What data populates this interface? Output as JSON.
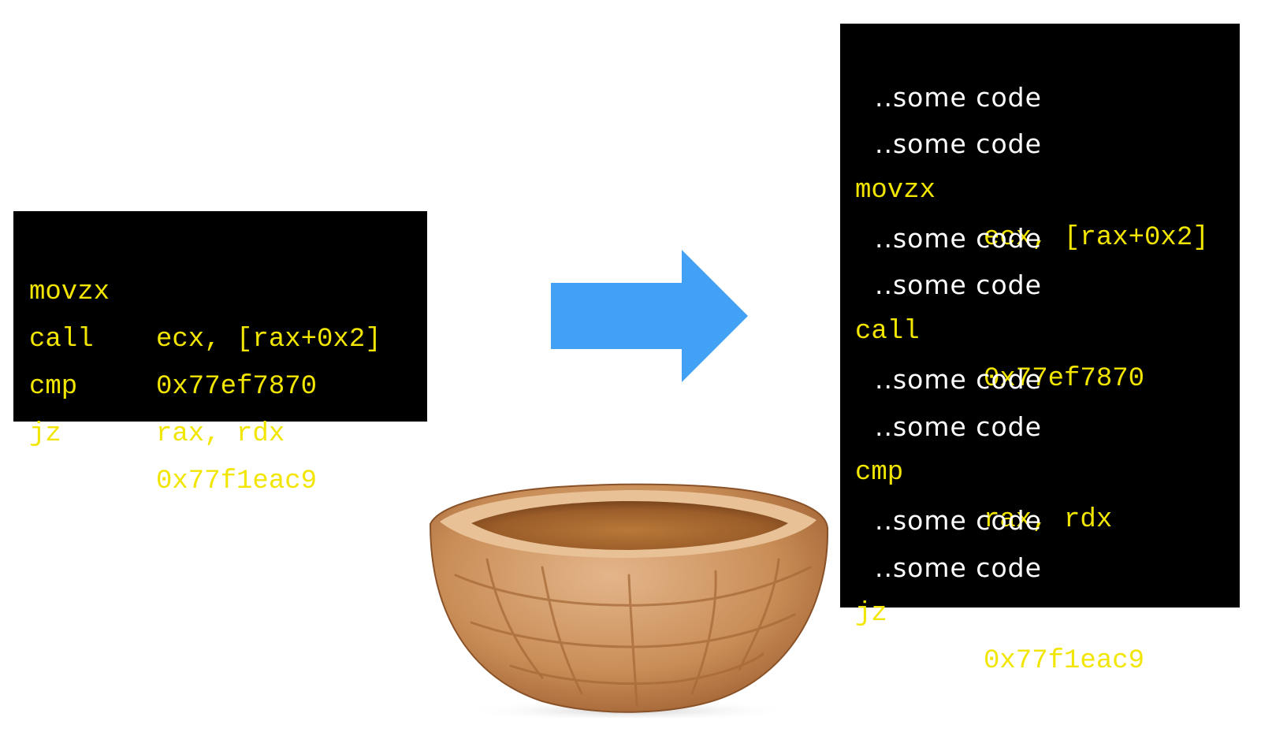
{
  "colors": {
    "background": "#ffffff",
    "panel": "#000000",
    "instruction_text": "#f2e600",
    "filler_text": "#ffffff",
    "arrow": "#42a1f4",
    "shell_light": "#e4b58a",
    "shell_dark": "#9a5a2c"
  },
  "icons": {
    "arrow": "right-arrow-icon",
    "shell": "walnut-shell-illustration"
  },
  "original_snippet": {
    "lines": [
      {
        "mnemonic": "movzx",
        "operand": "ecx, [rax+0x2]"
      },
      {
        "mnemonic": "call",
        "operand": "0x77ef7870"
      },
      {
        "mnemonic": "cmp",
        "operand": "rax, rdx"
      },
      {
        "mnemonic": "jz",
        "operand": "0x77f1eac9"
      }
    ]
  },
  "obfuscated_snippet": {
    "filler_text": "..some code",
    "lines": [
      {
        "kind": "filler",
        "text": "..some code"
      },
      {
        "kind": "filler",
        "text": "..some code"
      },
      {
        "kind": "instruction",
        "mnemonic": "movzx",
        "operand": "ecx, [rax+0x2]"
      },
      {
        "kind": "filler",
        "text": "..some code"
      },
      {
        "kind": "filler",
        "text": "..some code"
      },
      {
        "kind": "instruction",
        "mnemonic": "call",
        "operand": "0x77ef7870"
      },
      {
        "kind": "filler",
        "text": "..some code"
      },
      {
        "kind": "filler",
        "text": "..some code"
      },
      {
        "kind": "instruction",
        "mnemonic": "cmp",
        "operand": "rax, rdx"
      },
      {
        "kind": "filler",
        "text": "..some code"
      },
      {
        "kind": "filler",
        "text": "..some code"
      },
      {
        "kind": "instruction",
        "mnemonic": "jz",
        "operand": "0x77f1eac9"
      }
    ]
  }
}
